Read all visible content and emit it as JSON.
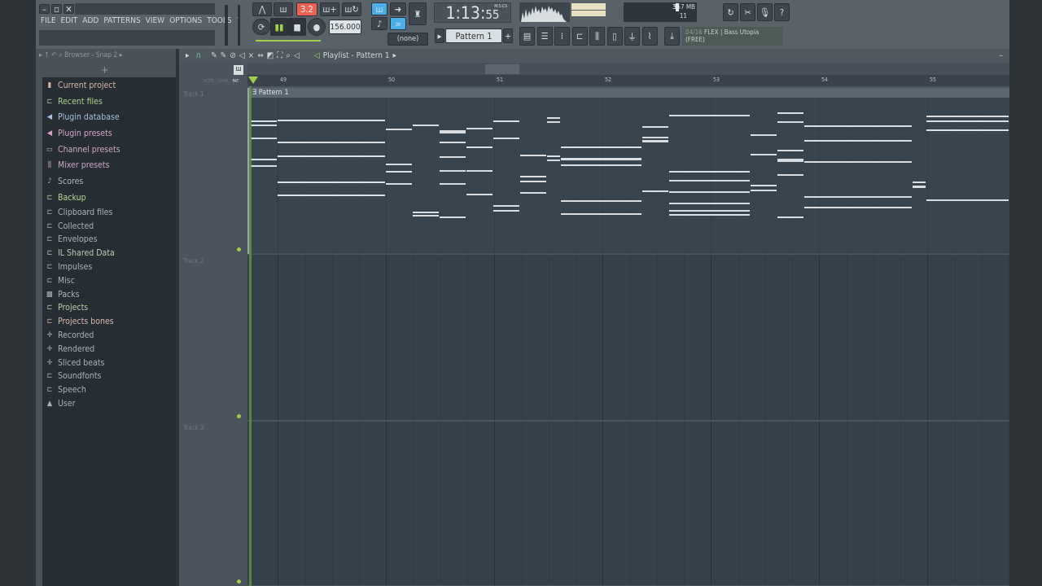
{
  "menu": [
    "FILE",
    "EDIT",
    "ADD",
    "PATTERNS",
    "VIEW",
    "OPTIONS",
    "TOOLS",
    "?"
  ],
  "transport": {
    "pattern_song": "3.2",
    "tempo": "156.000",
    "time": "1:13",
    "time_sub": "55",
    "time_unit": "M:S:CS",
    "pattern": "Pattern 1",
    "snap_none": "(none)"
  },
  "monitor": {
    "cpu": "3",
    "memory": "557 MB",
    "polyphony": "11"
  },
  "hint": {
    "line1": "04/16",
    "name": "FLEX | Bass Utopia",
    "line2": "(FREE)"
  },
  "browser": {
    "title": "Browser - Snap 2",
    "items": [
      {
        "label": "Current project",
        "color": "#d8b8a8",
        "icon": "file-icon"
      },
      {
        "label": "Recent files",
        "color": "#a8d090",
        "icon": "folder-refresh-icon"
      },
      {
        "label": "Plugin database",
        "color": "#a8c0dc",
        "icon": "plug-icon"
      },
      {
        "label": "Plugin presets",
        "color": "#d8a0c8",
        "icon": "plug-icon"
      },
      {
        "label": "Channel presets",
        "color": "#d0a8c8",
        "icon": "channel-icon"
      },
      {
        "label": "Mixer presets",
        "color": "#c8a8c8",
        "icon": "mixer-icon"
      },
      {
        "label": "Scores",
        "color": "#b0b8c0",
        "icon": "note-icon"
      },
      {
        "label": "Backup",
        "color": "#b8d898",
        "icon": "folder-refresh-icon"
      },
      {
        "label": "Clipboard files",
        "color": "#a8b4bc",
        "icon": "folder-icon"
      },
      {
        "label": "Collected",
        "color": "#a8b4bc",
        "icon": "folder-icon"
      },
      {
        "label": "Envelopes",
        "color": "#a8b4bc",
        "icon": "folder-icon"
      },
      {
        "label": "IL Shared Data",
        "color": "#b8d0b8",
        "icon": "folder-refresh-icon"
      },
      {
        "label": "Impulses",
        "color": "#a8b4bc",
        "icon": "folder-icon"
      },
      {
        "label": "Misc",
        "color": "#a8b4bc",
        "icon": "folder-icon"
      },
      {
        "label": "Packs",
        "color": "#a8b4bc",
        "icon": "packs-icon"
      },
      {
        "label": "Projects",
        "color": "#b8d0a8",
        "icon": "folder-refresh-icon"
      },
      {
        "label": "Projects bones",
        "color": "#d8b8b0",
        "icon": "folder-icon"
      },
      {
        "label": "Recorded",
        "color": "#a8b4bc",
        "icon": "waveform-icon"
      },
      {
        "label": "Rendered",
        "color": "#a8b4bc",
        "icon": "waveform-icon"
      },
      {
        "label": "Sliced beats",
        "color": "#a8b4bc",
        "icon": "waveform-icon"
      },
      {
        "label": "Soundfonts",
        "color": "#a8b4bc",
        "icon": "folder-icon"
      },
      {
        "label": "Speech",
        "color": "#a8b4bc",
        "icon": "folder-icon"
      },
      {
        "label": "User",
        "color": "#a8b4bc",
        "icon": "user-icon"
      }
    ]
  },
  "playlist": {
    "title": "Playlist - Pattern 1",
    "modes": [
      "NOTE",
      "CHAN",
      "PAT"
    ],
    "bars": [
      "49",
      "50",
      "51",
      "52",
      "53",
      "54",
      "55"
    ],
    "tracks": [
      "Track 1",
      "Track 2",
      "Track 3"
    ],
    "clip": "Pattern 1"
  },
  "colors": {
    "accent": "#9ed04a",
    "grid": "#34414b"
  }
}
